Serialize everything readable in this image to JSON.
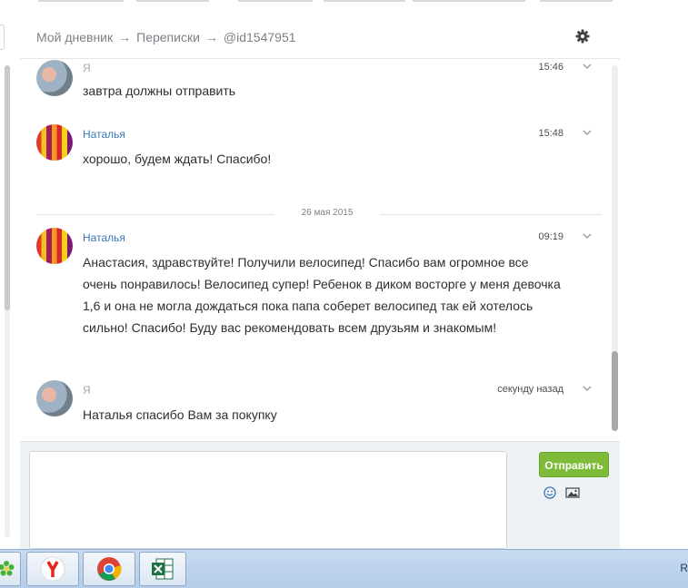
{
  "breadcrumb": {
    "items": [
      "Мой дневник",
      "Переписки",
      "@id1547951"
    ],
    "separator": "→"
  },
  "messages": [
    {
      "author": "Я",
      "time": "15:46",
      "text": "завтра должны отправить"
    },
    {
      "author": "Наталья",
      "time": "15:48",
      "text": "хорошо, будем ждать! Спасибо!"
    },
    {
      "author": "Наталья",
      "time": "09:19",
      "text": "Анастасия, здравствуйте! Получили велосипед! Спасибо вам огромное все очень понравилось! Велосипед супер! Ребенок в диком восторге у меня девочка 1,6 и она не могла дождаться пока папа соберет велосипед так ей хотелось сильно! Спасибо! Буду вас рекомендовать всем друзьям и знакомым!"
    },
    {
      "author": "Я",
      "time": "секунду назад",
      "text": "Наталья спасибо Вам за покупку"
    }
  ],
  "date_separator": "26 мая 2015",
  "composer": {
    "send_label": "Отправить"
  },
  "taskbar": {
    "apps": [
      "icq-icon",
      "yandex-browser-icon",
      "chrome-icon",
      "excel-icon"
    ],
    "tray_text": "R"
  },
  "colors": {
    "author_link": "#3a77b7",
    "send_button": "#7dbb38",
    "taskbar": "#c7daf0"
  }
}
